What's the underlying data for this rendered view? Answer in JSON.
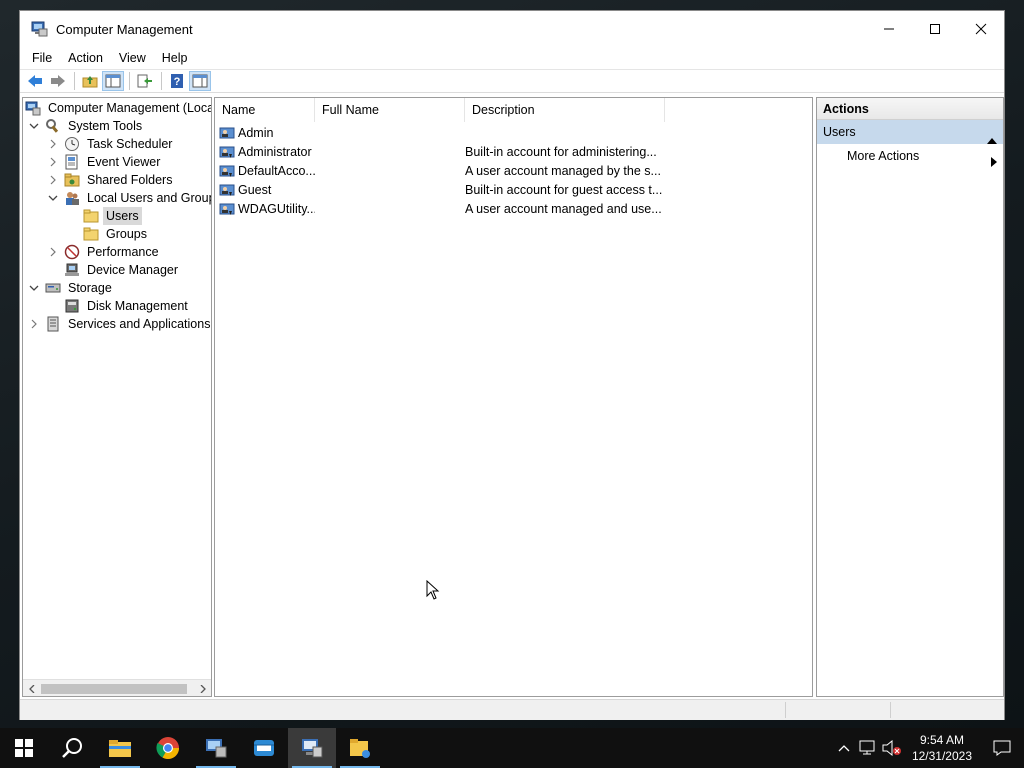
{
  "window": {
    "title": "Computer Management",
    "icon": "computer-management-icon"
  },
  "menu": [
    "File",
    "Action",
    "View",
    "Help"
  ],
  "tree": {
    "root": "Computer Management (Local",
    "items": [
      {
        "label": "System Tools",
        "icon": "system-tools-icon"
      },
      {
        "label": "Task Scheduler",
        "icon": "clock-icon"
      },
      {
        "label": "Event Viewer",
        "icon": "event-viewer-icon"
      },
      {
        "label": "Shared Folders",
        "icon": "shared-folder-icon"
      },
      {
        "label": "Local Users and Groups",
        "icon": "users-icon"
      },
      {
        "label": "Users",
        "icon": "folder-icon"
      },
      {
        "label": "Groups",
        "icon": "folder-icon"
      },
      {
        "label": "Performance",
        "icon": "performance-icon"
      },
      {
        "label": "Device Manager",
        "icon": "device-manager-icon"
      },
      {
        "label": "Storage",
        "icon": "storage-icon"
      },
      {
        "label": "Disk Management",
        "icon": "disk-icon"
      },
      {
        "label": "Services and Applications",
        "icon": "services-icon"
      }
    ]
  },
  "list": {
    "columns": [
      "Name",
      "Full Name",
      "Description"
    ],
    "rows": [
      {
        "name": "Admin",
        "full_name": "",
        "description": ""
      },
      {
        "name": "Administrator",
        "full_name": "",
        "description": "Built-in account for administering..."
      },
      {
        "name": "DefaultAcco...",
        "full_name": "",
        "description": "A user account managed by the s..."
      },
      {
        "name": "Guest",
        "full_name": "",
        "description": "Built-in account for guest access t..."
      },
      {
        "name": "WDAGUtility...",
        "full_name": "",
        "description": "A user account managed and use..."
      }
    ]
  },
  "actions": {
    "title": "Actions",
    "group": "Users",
    "items": [
      "More Actions"
    ]
  },
  "taskbar": {
    "apps": [
      "start-icon",
      "search-icon",
      "file-explorer-icon",
      "chrome-icon",
      "server-manager-icon",
      "virtualbox-icon",
      "computer-management-icon",
      "folder-app-icon"
    ],
    "active_index": 6,
    "time": "9:54 AM",
    "date": "12/31/2023"
  },
  "colors": {
    "selection": "#c6d9ec",
    "taskbar": "#101010",
    "accent": "#76b9ed"
  }
}
